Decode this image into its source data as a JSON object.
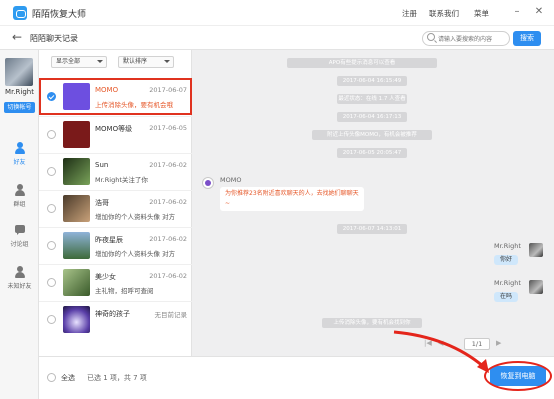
{
  "app": {
    "title": "陌陌恢复大师",
    "menu": [
      "注册",
      "联系我们",
      "菜单"
    ],
    "window_controls": [
      "–",
      "✕"
    ]
  },
  "nav": {
    "page_title": "陌陌聊天记录",
    "search_placeholder": "请输入要搜索的内容",
    "search_button": "搜索"
  },
  "account": {
    "name": "Mr.Right",
    "switch_label": "切换帐号"
  },
  "sidebar": {
    "items": [
      {
        "label": "好友",
        "icon": "person-icon",
        "active": true
      },
      {
        "label": "群组",
        "icon": "group-icon",
        "active": false
      },
      {
        "label": "讨论组",
        "icon": "chat-icon",
        "active": false
      },
      {
        "label": "未知好友",
        "icon": "unknown-person-icon",
        "active": false
      }
    ]
  },
  "filters": {
    "show": "显示全部",
    "sort": "默认排序"
  },
  "contacts": [
    {
      "name": "MOMO",
      "date": "2017-06-07",
      "msg": "上传消除头像，要有机会哦",
      "checked": true,
      "selected": true
    },
    {
      "name": "MOMO等级",
      "date": "2017-06-05",
      "msg": "",
      "checked": false,
      "selected": false
    },
    {
      "name": "Sun",
      "date": "2017-06-02",
      "msg": "Mr.Right关注了你",
      "checked": false,
      "selected": false
    },
    {
      "name": "浩哥",
      "date": "2017-06-02",
      "msg": "增加你的个人资料头像 对方",
      "checked": false,
      "selected": false
    },
    {
      "name": "昨夜星辰",
      "date": "2017-06-02",
      "msg": "增加你的个人资料头像 对方",
      "checked": false,
      "selected": false
    },
    {
      "name": "美少女",
      "date": "2017-06-02",
      "msg": "主礼物，招呼可查阅",
      "checked": false,
      "selected": false
    },
    {
      "name": "神奇的孩子",
      "date": "无目前记录",
      "msg": "",
      "checked": false,
      "selected": false
    }
  ],
  "chat": {
    "system_messages": [
      "APO有些提示消息可以查看",
      "2017-06-04 16:15:49",
      "最近状态：在线 1.7 人查看",
      "2017-06-04 16:17:13",
      "附近上传头像MOMO，有机会被推荐",
      "2017-06-05 20:05:47",
      "2017-06-07 14:13:01",
      "上传消除头像，要有机会找到你"
    ],
    "incoming": {
      "sender": "MOMO",
      "text_line1": "为你推荐23名附近喜欢聊天的人，去找她们聊聊天",
      "text_line2": "~"
    },
    "outgoing": [
      {
        "sender": "Mr.Right",
        "text": "你好"
      },
      {
        "sender": "Mr.Right",
        "text": "在吗"
      }
    ],
    "pager": "1/1"
  },
  "footer": {
    "select_all": "全选",
    "selection_info": "已选 1 项，共 7 项",
    "restore_button": "恢复到电脑"
  }
}
